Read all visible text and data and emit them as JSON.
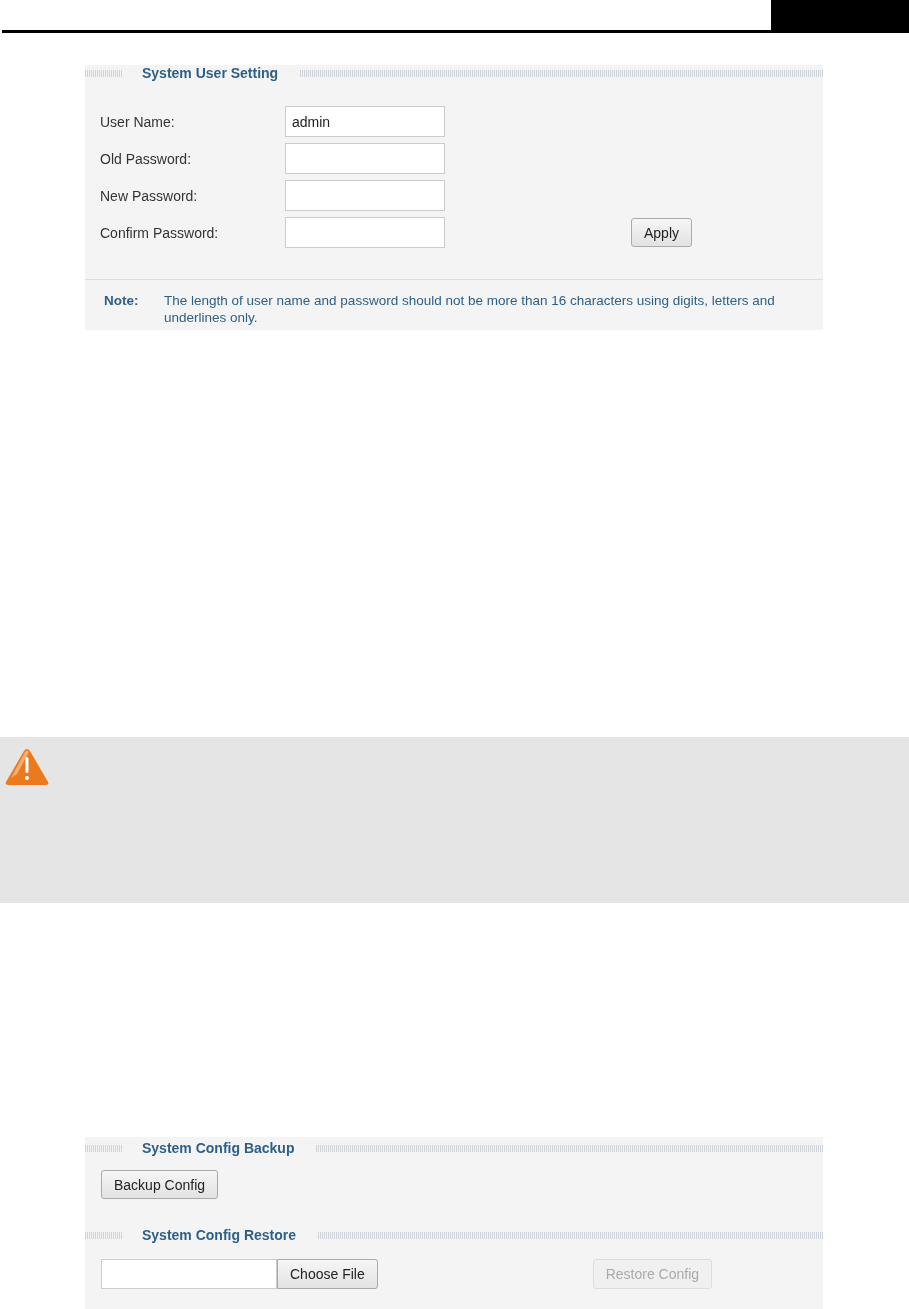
{
  "user_setting": {
    "title": "System User Setting",
    "fields": [
      {
        "label": "User Name:",
        "value": "admin"
      },
      {
        "label": "Old Password:"
      },
      {
        "label": "New Password:"
      },
      {
        "label": "Confirm Password:"
      }
    ],
    "apply_button": "Apply",
    "note": {
      "label": "Note:",
      "text": "The length of user name and password should not be more than 16 characters using digits, letters and underlines only."
    }
  },
  "config": {
    "backup": {
      "title": "System Config Backup",
      "button": "Backup Config"
    },
    "restore": {
      "title": "System Config Restore",
      "choose_button": "Choose File",
      "restore_button": {
        "label": "Restore Config",
        "disabled": true
      }
    }
  }
}
